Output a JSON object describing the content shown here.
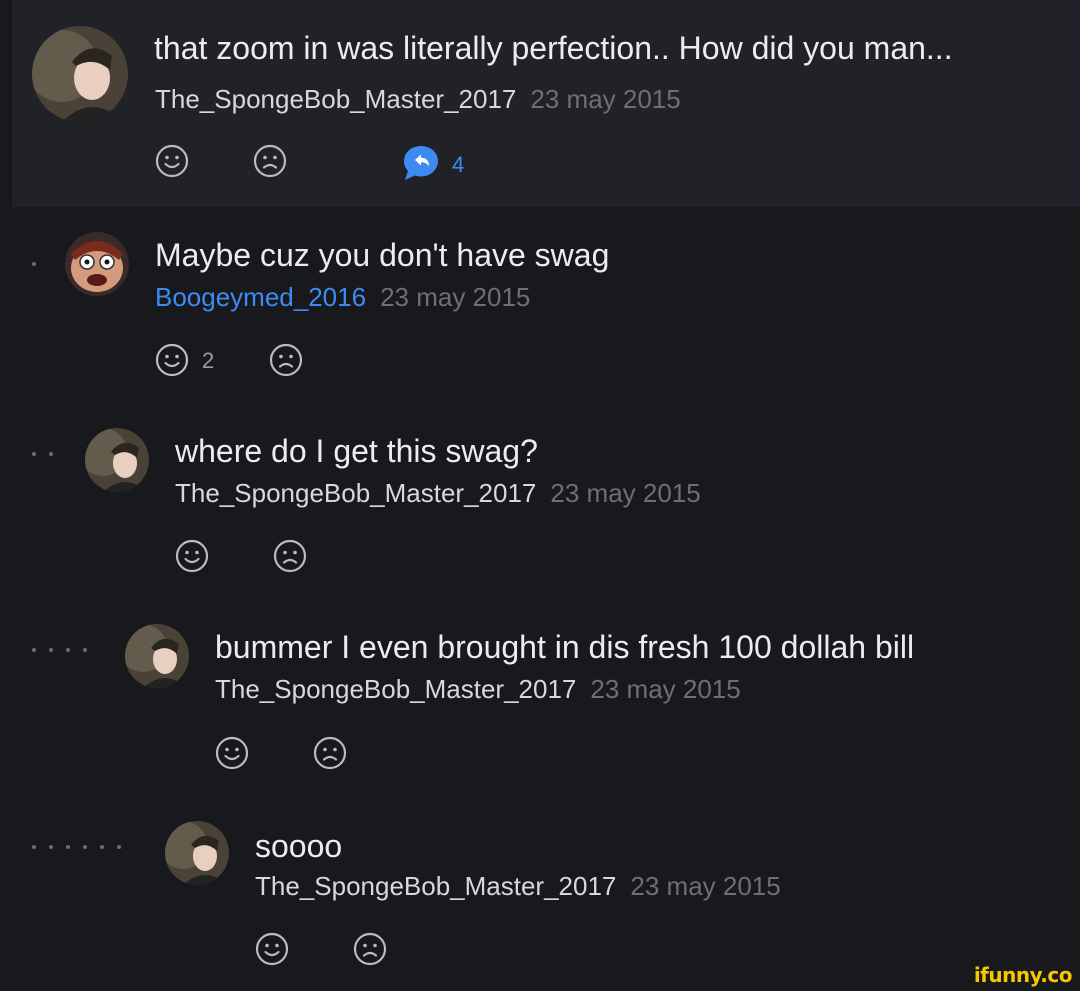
{
  "thread": {
    "root": {
      "text": "that zoom in was literally perfection.. How did you man...",
      "username": "The_SpongeBob_Master_2017",
      "date": "23 may 2015",
      "replies_count": "4"
    },
    "replies": [
      {
        "text": "Maybe cuz you don't have swag",
        "username": "Boogeymed_2016",
        "date": "23 may 2015",
        "likes_count": "2"
      },
      {
        "text": "where do I get this swag?",
        "username": "The_SpongeBob_Master_2017",
        "date": "23 may 2015"
      },
      {
        "text": "bummer I even brought in dis fresh 100 dollah bill",
        "username": "The_SpongeBob_Master_2017",
        "date": "23 may 2015"
      },
      {
        "text": "soooo",
        "username": "The_SpongeBob_Master_2017",
        "date": "23 may 2015"
      }
    ]
  },
  "watermark": "ifunny.co",
  "colors": {
    "background": "#18191d",
    "highlight": "#212227",
    "accent_blue": "#3d8bf2",
    "watermark_yellow": "#f7c600"
  },
  "icons": {
    "smile": "smile-icon",
    "frown": "frown-icon",
    "reply": "reply-bubble-icon"
  }
}
